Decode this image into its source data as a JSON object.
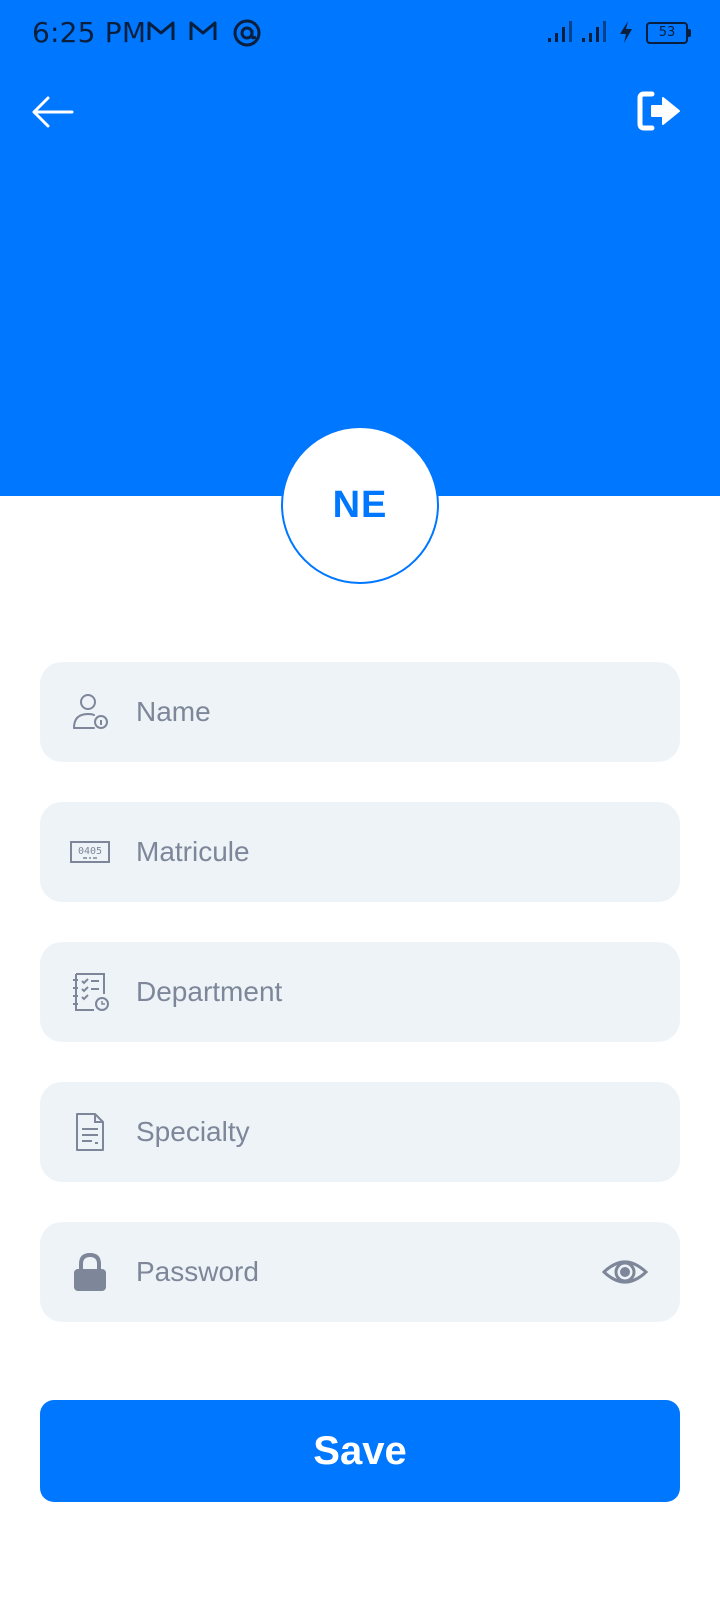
{
  "status_bar": {
    "time": "6:25 PM",
    "battery": "53",
    "icons": [
      "gmail-icon",
      "gmail-icon",
      "at-sign-icon",
      "signal-icon",
      "signal-icon",
      "charging-icon",
      "battery-icon"
    ]
  },
  "header": {
    "background_color": "#0077FF",
    "back_icon": "arrow-left-icon",
    "logout_icon": "logout-icon"
  },
  "avatar": {
    "initials": "NE"
  },
  "form": {
    "fields": [
      {
        "icon": "user-info-icon",
        "placeholder": "Name",
        "value": ""
      },
      {
        "icon": "id-badge-icon",
        "placeholder": "Matricule",
        "value": ""
      },
      {
        "icon": "checklist-icon",
        "placeholder": "Department",
        "value": ""
      },
      {
        "icon": "document-icon",
        "placeholder": "Specialty",
        "value": ""
      },
      {
        "icon": "lock-icon",
        "placeholder": "Password",
        "value": "",
        "trailing_icon": "eye-icon"
      }
    ],
    "field_background": "#EEF3F8",
    "placeholder_color": "#7D8799"
  },
  "save_button": {
    "label": "Save",
    "color": "#0077FF"
  }
}
